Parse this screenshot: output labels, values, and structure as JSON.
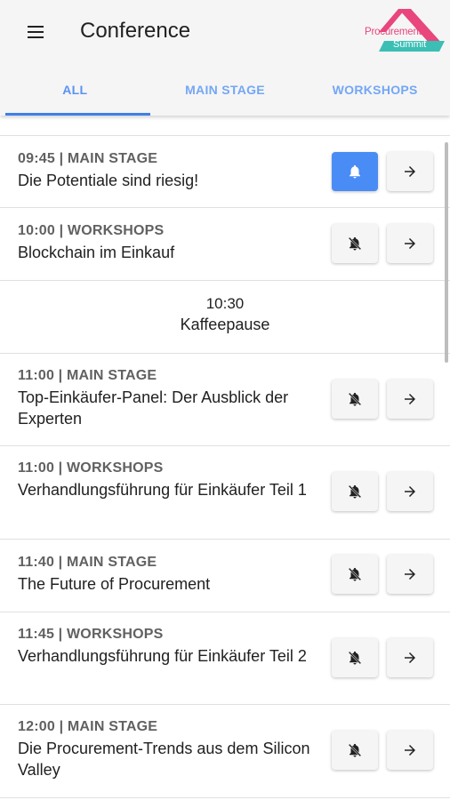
{
  "header": {
    "title": "Conference",
    "logo_line1": "Procurement",
    "logo_line2": "Summit",
    "brand_colors": {
      "pink": "#e8467c",
      "teal": "#3bbfb5"
    }
  },
  "tabs": [
    {
      "label": "ALL",
      "active": true
    },
    {
      "label": "MAIN STAGE",
      "active": false
    },
    {
      "label": "WORKSHOPS",
      "active": false
    }
  ],
  "sessions": [
    {
      "meta": "09:45 | MAIN STAGE",
      "title": "Die Potentiale sind riesig!",
      "reminder": true
    },
    {
      "meta": "10:00 | WORKSHOPS",
      "title": "Blockchain im Einkauf",
      "reminder": false
    },
    {
      "break_time": "10:30",
      "break_label": "Kaffeepause"
    },
    {
      "meta": "11:00 | MAIN STAGE",
      "title": "Top-Einkäufer-Panel: Der Ausblick der Experten",
      "reminder": false
    },
    {
      "meta": "11:00 | WORKSHOPS",
      "title": "Verhandlungsführung für Einkäufer Teil 1",
      "reminder": false
    },
    {
      "meta": "11:40 | MAIN STAGE",
      "title": "The Future of Procurement",
      "reminder": false
    },
    {
      "meta": "11:45 | WORKSHOPS",
      "title": "Verhandlungsführung für Einkäufer Teil 2",
      "reminder": false
    },
    {
      "meta": "12:00 | MAIN STAGE",
      "title": "Die Procurement-Trends aus dem Silicon Valley",
      "reminder": false
    }
  ],
  "icons": {
    "menu": "menu-icon",
    "bell_on": "bell-icon",
    "bell_off": "bell-off-icon",
    "arrow": "arrow-right-icon"
  },
  "colors": {
    "accent": "#3f7ee8",
    "active_bell_bg": "#4a8cf5",
    "appbar_bg": "#f5f5f5"
  }
}
